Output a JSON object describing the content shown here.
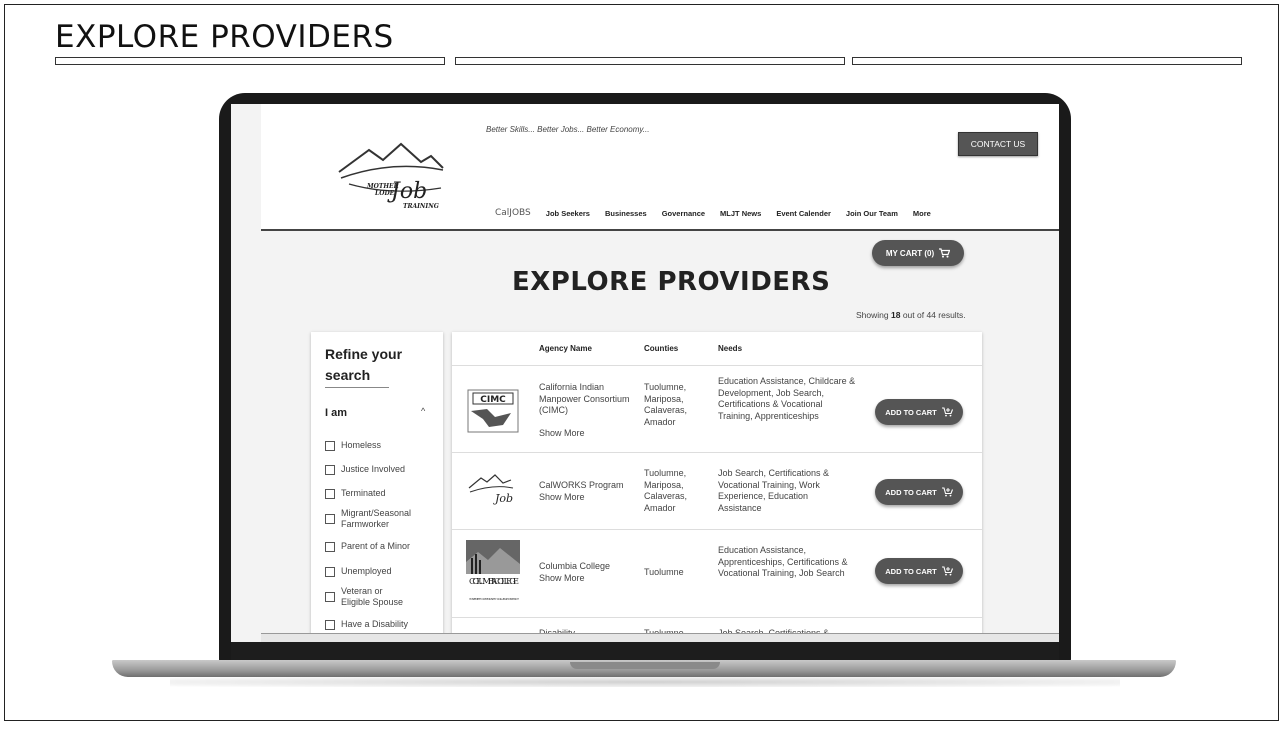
{
  "slide": {
    "title": "EXPLORE PROVIDERS"
  },
  "site": {
    "tagline": "Better Skills... Better Jobs... Better Economy...",
    "logo_text": [
      "MOTHER",
      "LODE",
      "Job",
      "TRAINING"
    ],
    "contact_label": "CONTACT US",
    "nav": [
      "CalJOBS",
      "Job Seekers",
      "Businesses",
      "Governance",
      "MLJT News",
      "Event Calender",
      "Join Our Team",
      "More"
    ],
    "cart_label": "MY CART (0)",
    "heading": "EXPLORE PROVIDERS",
    "results_prefix": "Showing",
    "results_count": "18",
    "results_suffix": "out of 44 results."
  },
  "filter": {
    "title": "Refine your search",
    "group_label": "I am",
    "options": [
      "Homeless",
      "Justice Involved",
      "Terminated",
      "Migrant/Seasonal Farmworker",
      "Parent of a Minor",
      "Unemployed",
      "Veteran or Eligible Spouse",
      "Have a Disability"
    ]
  },
  "table": {
    "headers": {
      "agency": "Agency Name",
      "counties": "Counties",
      "needs": "Needs"
    },
    "add_label": "ADD TO CART",
    "rows": [
      {
        "logo": "CIMC",
        "agency": "California Indian Manpower Consortium (CIMC)",
        "show_more": "Show More",
        "counties": "Tuolumne, Mariposa, Calaveras, Amador",
        "needs": "Education Assistance, Childcare & Development, Job Search, Certifications & Vocational Training, Apprenticeships"
      },
      {
        "logo": "Mother Lode Job Training",
        "agency": "CalWORKS Program",
        "show_more": "Show More",
        "counties": "Tuolumne, Mariposa, Calaveras, Amador",
        "needs": "Job Search, Certifications & Vocational Training, Work Experience, Education Assistance"
      },
      {
        "logo": "COLUMBIA COLLEGE",
        "logo_sub": "YOSEMITE COMMUNITY COLLEGE DISTRICT",
        "agency": "Columbia College",
        "show_more": "Show More",
        "counties": "Tuolumne",
        "needs": "Education Assistance, Apprenticeships, Certifications & Vocational Training, Job Search"
      },
      {
        "agency": "Disability",
        "counties": "Tuolumne",
        "needs": "Job Search, Certifications &"
      }
    ]
  }
}
